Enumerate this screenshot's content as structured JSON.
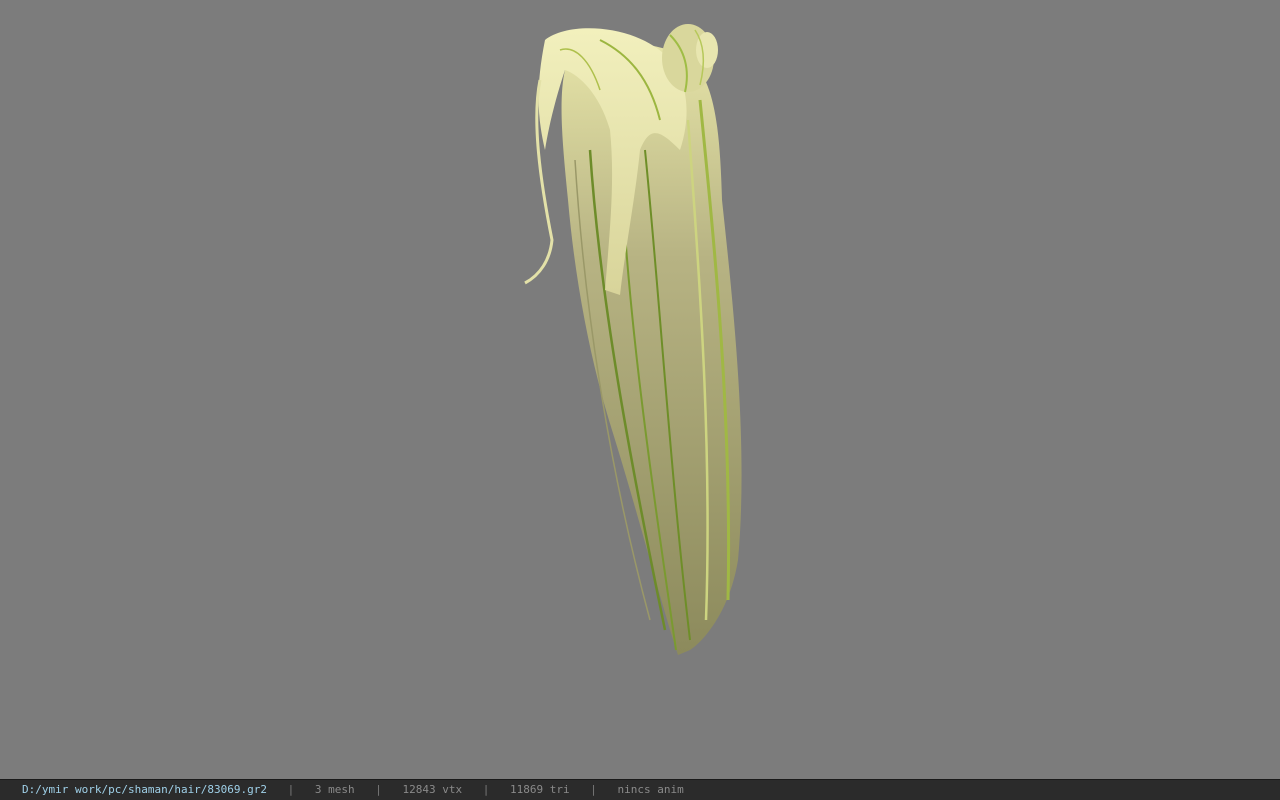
{
  "viewer": {
    "background_color": "#7c7c7c",
    "model_description_icon": "hair-mesh"
  },
  "statusbar": {
    "file_path": "D:/ymir work/pc/shaman/hair/83069.gr2",
    "separator": "|",
    "mesh_count": "3 mesh",
    "vertex_count": "12843 vtx",
    "triangle_count": "11869 tri",
    "anim_status": "nincs anim"
  }
}
